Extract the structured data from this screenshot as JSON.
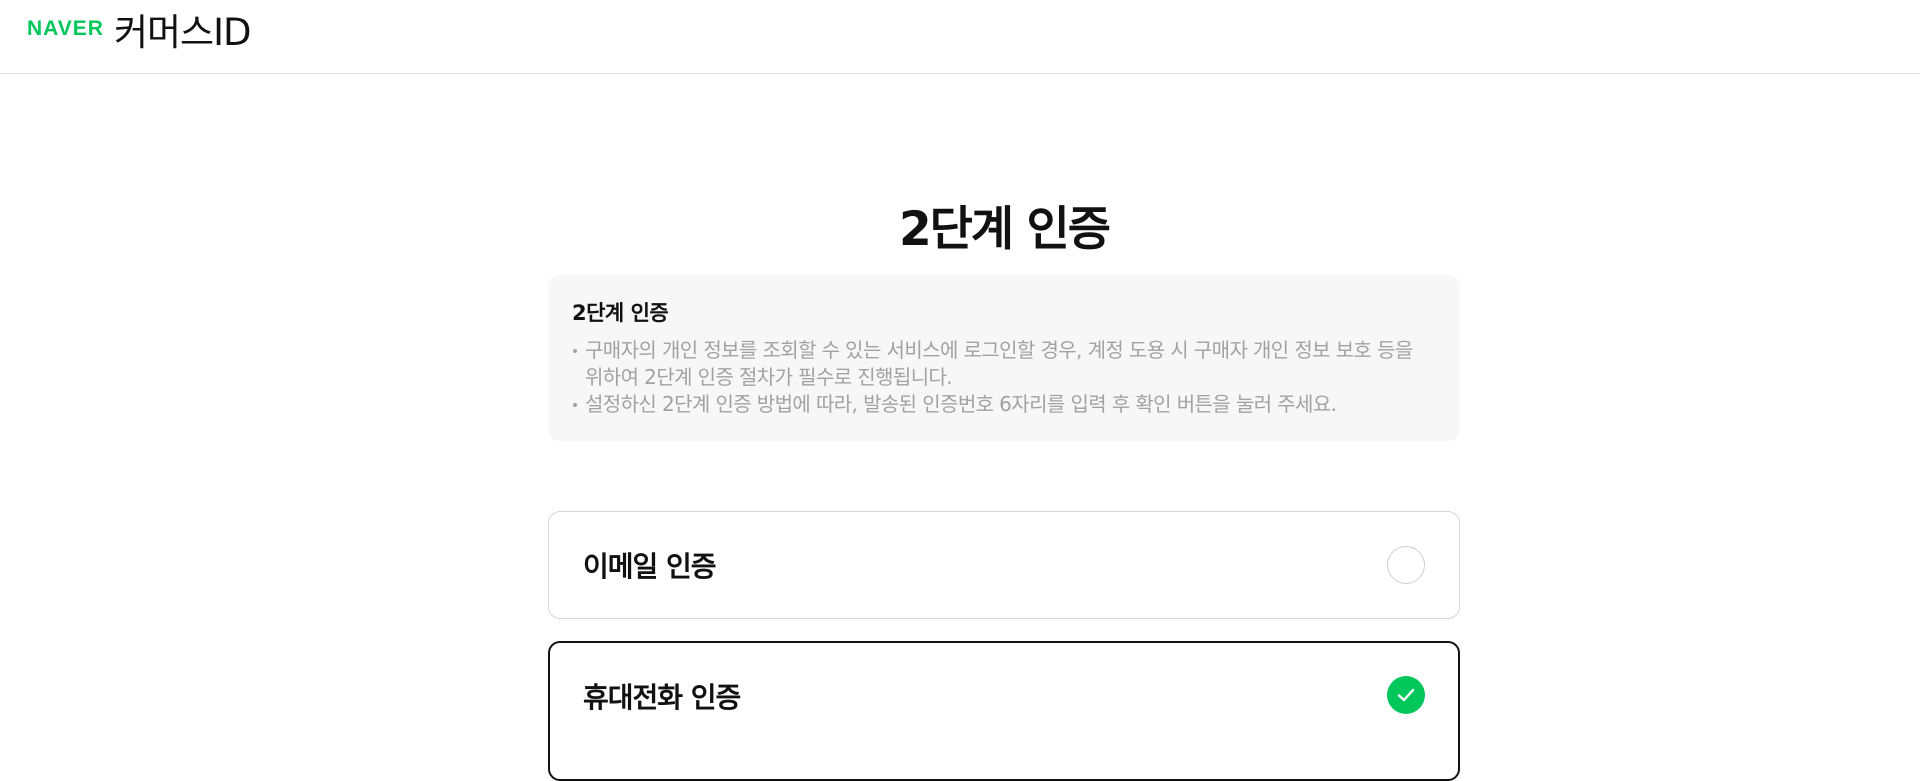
{
  "header": {
    "brand": "NAVER",
    "service": "커머스ID"
  },
  "page": {
    "title": "2단계 인증"
  },
  "notice": {
    "title": "2단계 인증",
    "items": [
      "구매자의 개인 정보를 조회할 수 있는 서비스에 로그인할 경우, 계정 도용 시 구매자 개인 정보 보호 등을 위하여 2단계 인증 절차가 필수로 진행됩니다.",
      "설정하신 2단계 인증 방법에 따라, 발송된 인증번호 6자리를 입력 후 확인 버튼을 눌러 주세요."
    ]
  },
  "options": [
    {
      "label": "이메일 인증",
      "selected": false,
      "icon": "radio-empty-icon"
    },
    {
      "label": "휴대전화 인증",
      "selected": true,
      "icon": "check-icon"
    }
  ],
  "colors": {
    "brand_green": "#03c75a",
    "text_primary": "#111111",
    "text_muted": "#a2a2a2",
    "notice_bg": "#f7f7f7"
  }
}
